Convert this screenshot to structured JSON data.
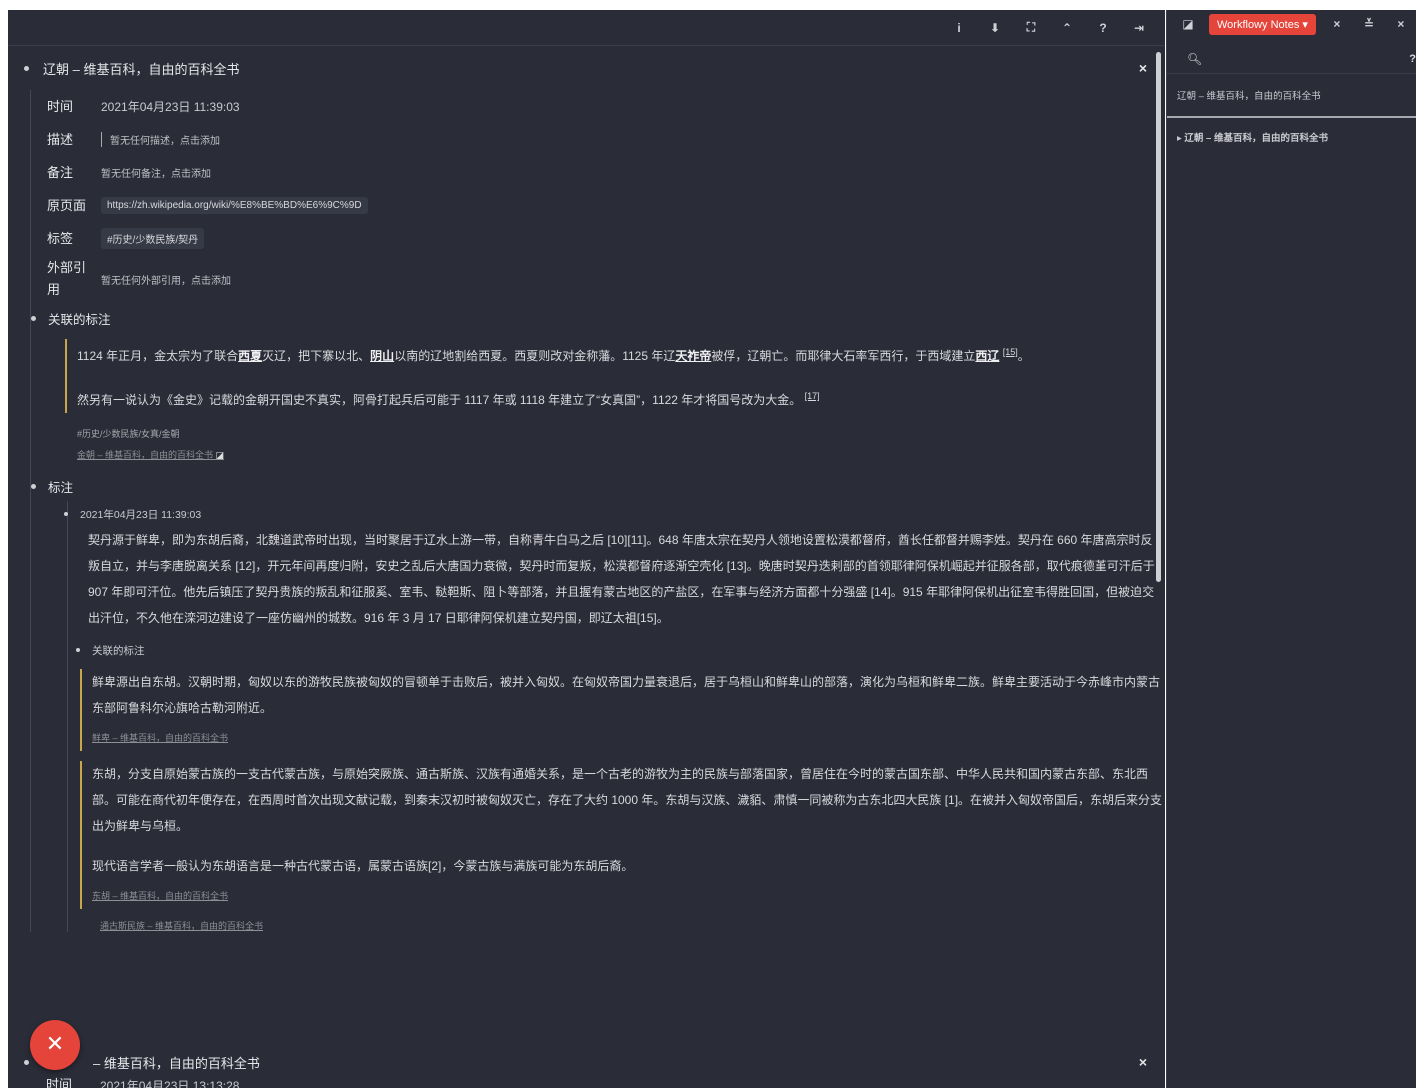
{
  "toolbar": {
    "icons": [
      "info-icon",
      "download-icon",
      "sitemap-icon",
      "collapse-icon",
      "help-icon",
      "exit-icon"
    ],
    "labels": {
      "info": "i",
      "download": "⬇",
      "sitemap": "⛶",
      "collapse": "⌃",
      "help": "?",
      "exit": "⇥"
    }
  },
  "entry1": {
    "title": "辽朝 – 维基百科，自由的百科全书",
    "close": "×",
    "fields": {
      "time_label": "时间",
      "time_value": "2021年04月23日 11:39:03",
      "desc_label": "描述",
      "desc_value": "暂无任何描述，点击添加",
      "note_label": "备注",
      "note_value": "暂无任何备注，点击添加",
      "page_label": "原页面",
      "page_value": "https://zh.wikipedia.org/wiki/%E8%BE%BD%E6%9C%9D",
      "tag_label": "标签",
      "tag_value": "#历史/少数民族/契丹",
      "ext_label": "外部引用",
      "ext_value": "暂无任何外部引用，点击添加"
    },
    "related": {
      "title": "关联的标注",
      "p1_a": "1124 年正月，金太宗为了联合",
      "p1_l1": "西夏",
      "p1_b": "灭辽，把下寨以北、",
      "p1_l2": "阴山",
      "p1_c": "以南的辽地割给西夏。西夏则改对金称藩。1125 年辽",
      "p1_l3": "天祚帝",
      "p1_d": "被俘，辽朝亡。而耶律大石率军西行，于西域建立",
      "p1_l4": "西辽",
      "p1_sup": "[15]",
      "p1_e": "。",
      "p2": "然另有一说认为《金史》记载的金朝开国史不真实，阿骨打起兵后可能于 1117 年或 1118 年建立了“女真国”，1122 年才将国号改为大金。",
      "p2_sup": "[17]",
      "tag": "#历史/少数民族/女真/金朝",
      "link": "金朝 – 维基百科，自由的百科全书"
    },
    "notes": {
      "title": "标注",
      "time": "2021年04月23日 11:39:03",
      "para": "契丹源于鲜卑，即为东胡后裔，北魏道武帝时出现，当时聚居于辽水上游一带，自称青牛白马之后 [10][11]。648 年唐太宗在契丹人领地设置松漠都督府，酋长任都督并赐李姓。契丹在 660 年唐高宗时反叛自立，并与李唐脱离关系 [12]，开元年间再度归附，安史之乱后大唐国力衰微，契丹时而复叛，松漠都督府逐渐空壳化 [13]。晚唐时契丹迭剌部的首领耶律阿保机崛起并征服各部，取代痕德堇可汗后于 907 年即可汗位。他先后镇压了契丹贵族的叛乱和征服奚、室韦、鞑靼斯、阻卜等部落，并且握有蒙古地区的产盐区，在军事与经济方面都十分强盛 [14]。915 年耶律阿保机出征室韦得胜回国，但被迫交出汗位，不久他在滦河边建设了一座仿幽州的城数。916 年 3 月 17 日耶律阿保机建立契丹国，即辽太祖[15]。",
      "related_title": "关联的标注",
      "q1": "鲜卑源出自东胡。汉朝时期，匈奴以东的游牧民族被匈奴的冒顿单于击败后，被并入匈奴。在匈奴帝国力量衰退后，居于乌桓山和鲜卑山的部落，演化为乌桓和鲜卑二族。鲜卑主要活动于今赤峰市内蒙古东部阿鲁科尔沁旗哈古勒河附近。",
      "q1_src": "鲜卑 – 维基百科，自由的百科全书",
      "q2a": "东胡，分支自原始蒙古族的一支古代蒙古族，与原始突厥族、通古斯族、汉族有通婚关系，是一个古老的游牧为主的民族与部落国家，曾居住在今时的蒙古国东部、中华人民共和国内蒙古东部、东北西部。可能在商代初年便存在，在西周时首次出现文献记载，到秦末汉初时被匈奴灭亡，存在了大约 1000 年。东胡与汉族、濊貊、肃慎一同被称为古东北四大民族 [1]。在被并入匈奴帝国后，东胡后来分支出为鲜卑与乌桓。",
      "q2b": "现代语言学者一般认为东胡语言是一种古代蒙古语，属蒙古语族[2]，今蒙古族与满族可能为东胡后裔。",
      "q2_src": "东胡 – 维基百科，自由的百科全书",
      "q3_src": "通古斯民族 – 维基百科，自由的百科全书"
    }
  },
  "entry2": {
    "title": "– 维基百科，自由的百科全书",
    "close": "×",
    "time_label": "时间",
    "time_value": "2021年04月23日 13:13:28"
  },
  "fab": "✕",
  "sidebar": {
    "notes_button": "Workflowy Notes ▾",
    "close": "×",
    "collapse": "≚",
    "extra": "×",
    "help": "?",
    "header_item": "辽朝 – 维基百科，自由的百科全书",
    "tree_item": "▸ 辽朝 – 维基百科，自由的百科全书"
  }
}
